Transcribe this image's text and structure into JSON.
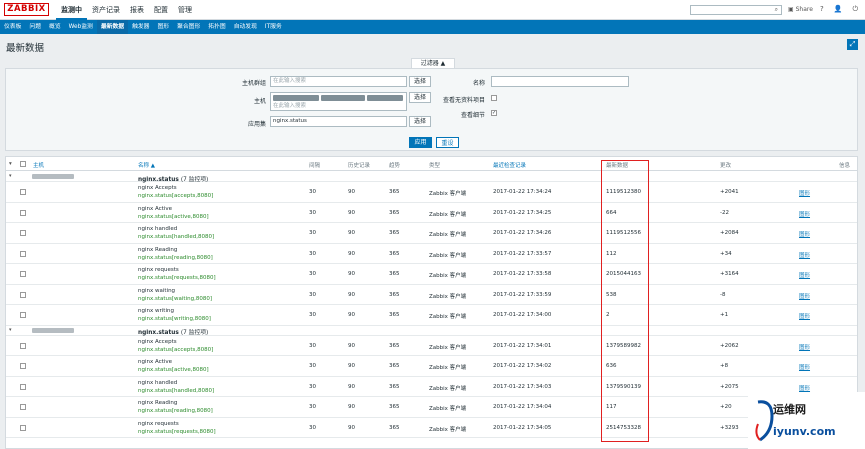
{
  "logo": "ZABBIX",
  "top_menu": [
    "监测中",
    "资产记录",
    "报表",
    "配置",
    "管理"
  ],
  "share_label": "Share",
  "top_icons": [
    "?",
    "👤",
    "⏻"
  ],
  "sub_menu": [
    "仪表板",
    "问题",
    "概览",
    "Web监测",
    "最新数据",
    "触发器",
    "图形",
    "聚合图形",
    "拓扑图",
    "自动发现",
    "IT服务"
  ],
  "page_title": "最新数据",
  "filter": {
    "tab": "过滤器 ▲",
    "hostgroup_label": "主机群组",
    "hostgroup_placeholder": "在此输入搜索",
    "host_label": "主机",
    "host_placeholder": "在此输入搜索",
    "app_label": "应用集",
    "app_value": "nginx.status",
    "select": "选择",
    "name_label": "名称",
    "show_nodata_label": "查看无资料项目",
    "show_details_label": "查看细节",
    "apply": "应用",
    "reset": "重设"
  },
  "columns": {
    "host": "主机",
    "name": "名称 ▲",
    "interval": "间隔",
    "history": "历史记录",
    "trends": "趋势",
    "type": "类型",
    "lastcheck": "最近检查记录",
    "lastvalue": "最新数据",
    "change": "更改",
    "info": "信息"
  },
  "groups": [
    {
      "name": "nginx.status",
      "count": "(7 监控项)",
      "items": [
        {
          "name": "nginx Accepts",
          "key": "nginx.status[accepts,8080]",
          "interval": "30",
          "history": "90",
          "trends": "365",
          "type": "Zabbix 客户端",
          "lastcheck": "2017-01-22 17:34:24",
          "lastvalue": "1119512380",
          "change": "+2041",
          "graph": "图形"
        },
        {
          "name": "nginx Active",
          "key": "nginx.status[active,8080]",
          "interval": "30",
          "history": "90",
          "trends": "365",
          "type": "Zabbix 客户端",
          "lastcheck": "2017-01-22 17:34:25",
          "lastvalue": "664",
          "change": "-22",
          "graph": "图形"
        },
        {
          "name": "nginx handled",
          "key": "nginx.status[handled,8080]",
          "interval": "30",
          "history": "90",
          "trends": "365",
          "type": "Zabbix 客户端",
          "lastcheck": "2017-01-22 17:34:26",
          "lastvalue": "1119512556",
          "change": "+2084",
          "graph": "图形"
        },
        {
          "name": "nginx Reading",
          "key": "nginx.status[reading,8080]",
          "interval": "30",
          "history": "90",
          "trends": "365",
          "type": "Zabbix 客户端",
          "lastcheck": "2017-01-22 17:33:57",
          "lastvalue": "112",
          "change": "+34",
          "graph": "图形"
        },
        {
          "name": "nginx requests",
          "key": "nginx.status[requests,8080]",
          "interval": "30",
          "history": "90",
          "trends": "365",
          "type": "Zabbix 客户端",
          "lastcheck": "2017-01-22 17:33:58",
          "lastvalue": "2015044163",
          "change": "+3164",
          "graph": "图形"
        },
        {
          "name": "nginx waiting",
          "key": "nginx.status[waiting,8080]",
          "interval": "30",
          "history": "90",
          "trends": "365",
          "type": "Zabbix 客户端",
          "lastcheck": "2017-01-22 17:33:59",
          "lastvalue": "538",
          "change": "-8",
          "graph": "图形"
        },
        {
          "name": "nginx writing",
          "key": "nginx.status[writing,8080]",
          "interval": "30",
          "history": "90",
          "trends": "365",
          "type": "Zabbix 客户端",
          "lastcheck": "2017-01-22 17:34:00",
          "lastvalue": "2",
          "change": "+1",
          "graph": "图形"
        }
      ]
    },
    {
      "name": "nginx.status",
      "count": "(7 监控项)",
      "items": [
        {
          "name": "nginx Accepts",
          "key": "nginx.status[accepts,8080]",
          "interval": "30",
          "history": "90",
          "trends": "365",
          "type": "Zabbix 客户端",
          "lastcheck": "2017-01-22 17:34:01",
          "lastvalue": "1379589982",
          "change": "+2062",
          "graph": "图形"
        },
        {
          "name": "nginx Active",
          "key": "nginx.status[active,8080]",
          "interval": "30",
          "history": "90",
          "trends": "365",
          "type": "Zabbix 客户端",
          "lastcheck": "2017-01-22 17:34:02",
          "lastvalue": "636",
          "change": "+8",
          "graph": "图形"
        },
        {
          "name": "nginx handled",
          "key": "nginx.status[handled,8080]",
          "interval": "30",
          "history": "90",
          "trends": "365",
          "type": "Zabbix 客户端",
          "lastcheck": "2017-01-22 17:34:03",
          "lastvalue": "1379590139",
          "change": "+2075",
          "graph": "图形"
        },
        {
          "name": "nginx Reading",
          "key": "nginx.status[reading,8080]",
          "interval": "30",
          "history": "90",
          "trends": "365",
          "type": "Zabbix 客户端",
          "lastcheck": "2017-01-22 17:34:04",
          "lastvalue": "117",
          "change": "+20",
          "graph": "图形"
        },
        {
          "name": "nginx requests",
          "key": "nginx.status[requests,8080]",
          "interval": "30",
          "history": "90",
          "trends": "365",
          "type": "Zabbix 客户端",
          "lastcheck": "2017-01-22 17:34:05",
          "lastvalue": "2514753328",
          "change": "+3293",
          "graph": "图形"
        }
      ]
    }
  ],
  "watermark": {
    "line1": "运维网",
    "line2": "iyunv.com"
  }
}
